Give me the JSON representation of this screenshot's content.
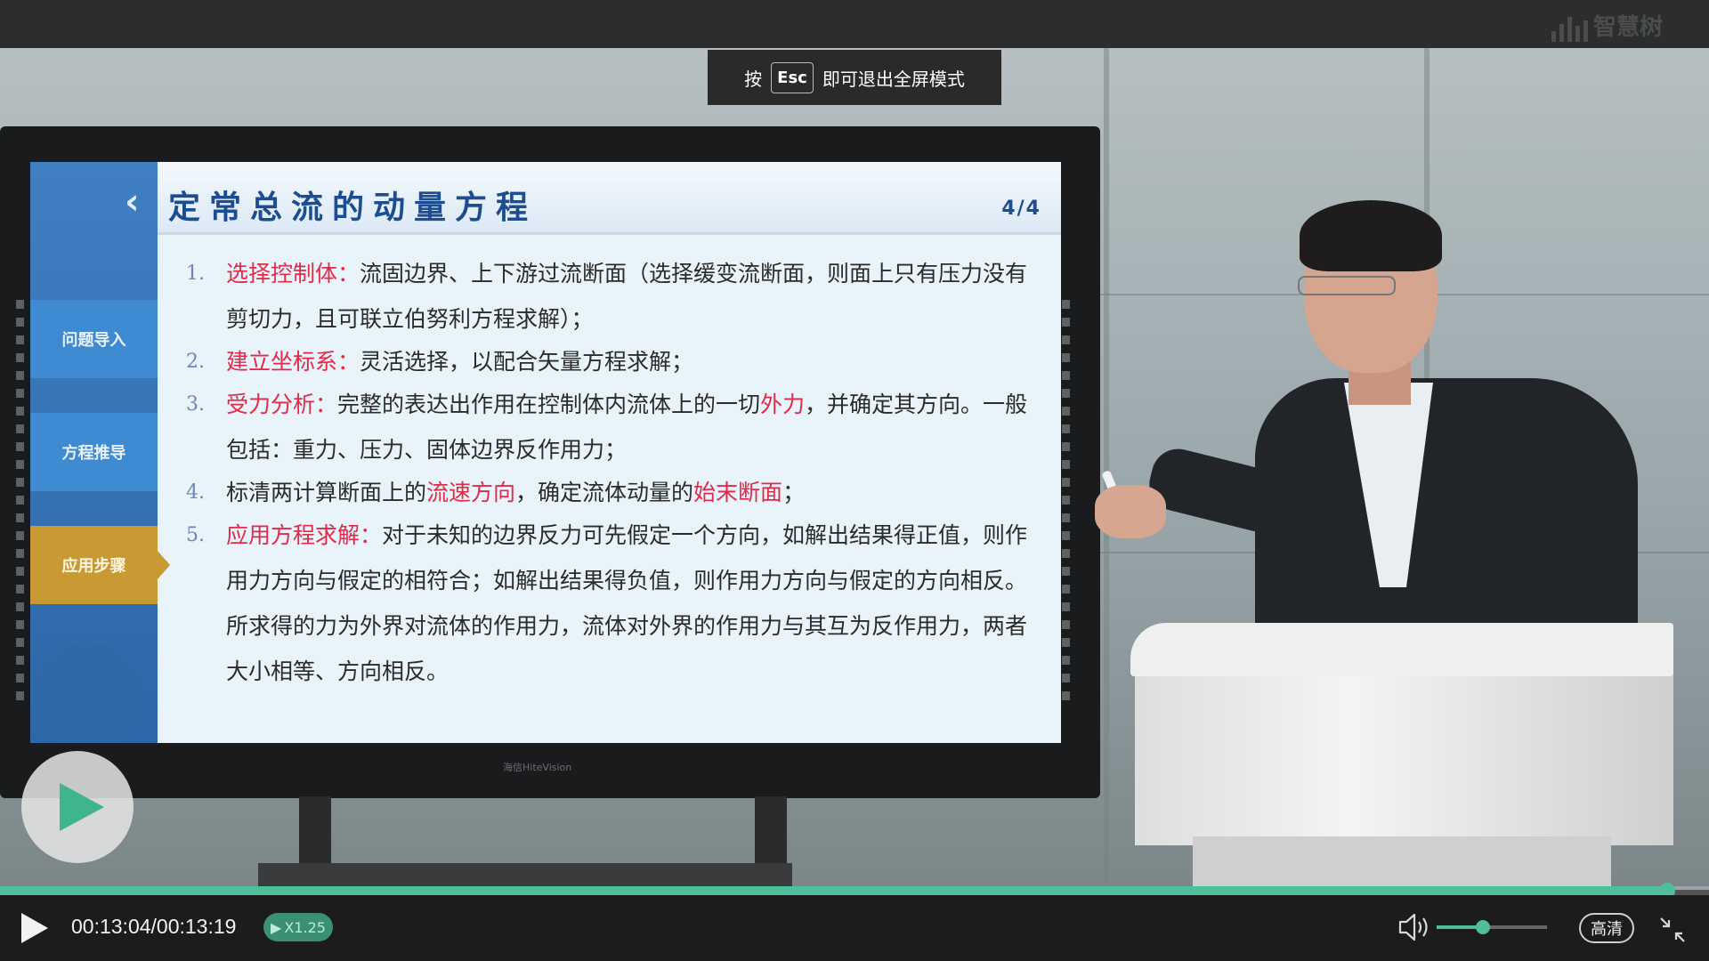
{
  "brand": {
    "name": "智慧树"
  },
  "fullscreen_notice": {
    "prefix": "按",
    "key": "Esc",
    "suffix": "即可退出全屏模式"
  },
  "slide": {
    "title": "定常总流的动量方程",
    "page": "4/4",
    "nav_items": [
      "问题导入",
      "方程推导",
      "应用步骤"
    ],
    "active_nav": "应用步骤",
    "items": [
      {
        "num": "1.",
        "parts": [
          {
            "t": "选择控制体：",
            "red": true
          },
          {
            "t": "流固边界、上下游过流断面（选择缓变流断面，则面上只有压力没有剪切力，且可联立伯努利方程求解）；",
            "red": false
          }
        ]
      },
      {
        "num": "2.",
        "parts": [
          {
            "t": "建立坐标系：",
            "red": true
          },
          {
            "t": "灵活选择，以配合矢量方程求解；",
            "red": false
          }
        ]
      },
      {
        "num": "3.",
        "parts": [
          {
            "t": "受力分析：",
            "red": true
          },
          {
            "t": "完整的表达出作用在控制体内流体上的一切",
            "red": false
          },
          {
            "t": "外力",
            "red": true
          },
          {
            "t": "，并确定其方向。一般包括：重力、压力、固体边界反作用力；",
            "red": false
          }
        ]
      },
      {
        "num": "4.",
        "parts": [
          {
            "t": "标清两计算断面上的",
            "red": false
          },
          {
            "t": "流速方向",
            "red": true
          },
          {
            "t": "，确定流体动量的",
            "red": false
          },
          {
            "t": "始末断面",
            "red": true
          },
          {
            "t": "；",
            "red": false
          }
        ]
      },
      {
        "num": "5.",
        "parts": [
          {
            "t": "应用方程求解：",
            "red": true
          },
          {
            "t": "对于未知的边界反力可先假定一个方向，如解出结果得正值，则作用力方向与假定的相符合；如解出结果得负值，则作用力方向与假定的方向相反。所求得的力为外界对流体的作用力，流体对外界的作用力与其互为反作用力，两者大小相等、方向相反。",
            "red": false
          }
        ]
      }
    ],
    "monitor_brand": "海信HiteVision"
  },
  "player": {
    "time_display": "00:13:04/00:13:19",
    "current": "00:13:04",
    "duration": "00:13:19",
    "progress_fraction": 0.9757,
    "speed_label": "X1.25",
    "volume_fraction": 0.42,
    "quality_label": "高清"
  },
  "icons": {
    "big_play": "play-icon",
    "play": "play-icon",
    "volume": "volume-icon",
    "exit_fullscreen": "exit-fullscreen-icon"
  },
  "colors": {
    "accent": "#4fbf9b",
    "highlight_text": "#e02a48",
    "slide_title": "#1d4d91",
    "nav_active": "#c89a34"
  }
}
